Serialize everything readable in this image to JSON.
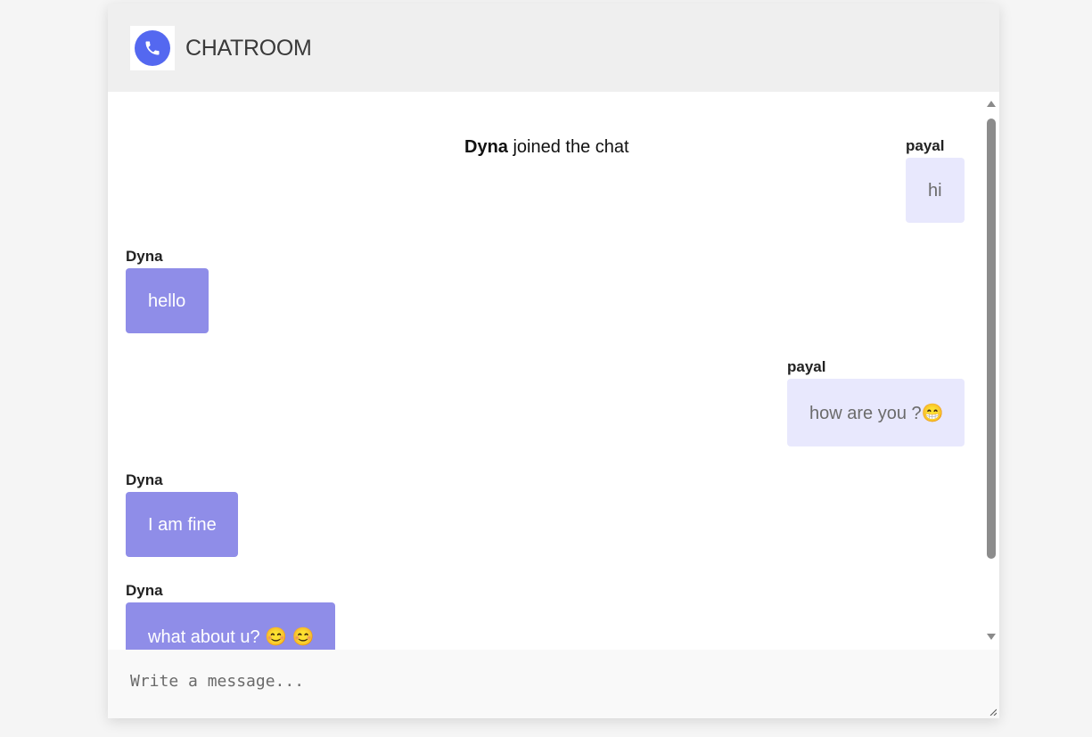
{
  "header": {
    "title": "CHATROOM",
    "logo_icon": "phone-icon",
    "logo_color": "#5468f0"
  },
  "chat": {
    "join_notice": {
      "user": "Dyna",
      "text": " joined the chat"
    },
    "messages": [
      {
        "sender": "payal",
        "text": "hi",
        "direction": "outgoing"
      },
      {
        "sender": "Dyna",
        "text": "hello",
        "direction": "incoming"
      },
      {
        "sender": "payal",
        "text": "how are you ?😁",
        "direction": "outgoing"
      },
      {
        "sender": "Dyna",
        "text": "I am fine",
        "direction": "incoming"
      },
      {
        "sender": "Dyna",
        "text": "what about u? 😊 😊",
        "direction": "incoming"
      }
    ]
  },
  "composer": {
    "placeholder": "Write a message...",
    "value": ""
  },
  "colors": {
    "outgoing_bubble": "#e8e8fd",
    "incoming_bubble": "#8f8de8",
    "header_bg": "#efefef"
  }
}
